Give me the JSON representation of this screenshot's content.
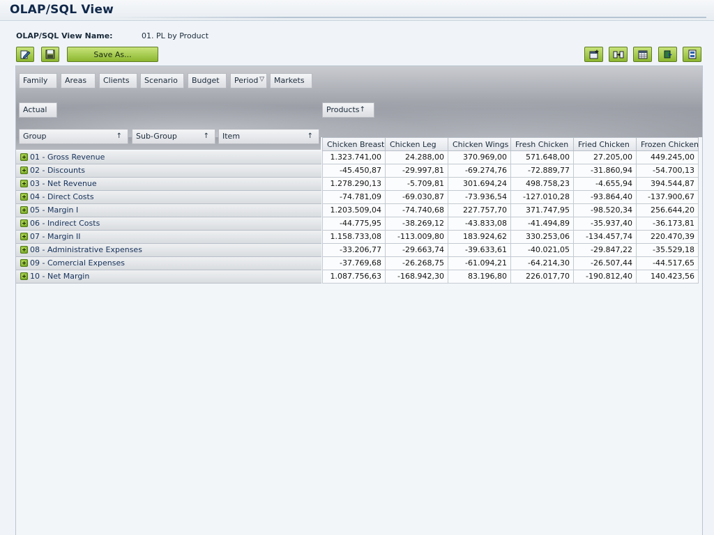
{
  "page": {
    "title": "OLAP/SQL View"
  },
  "view_name": {
    "label": "OLAP/SQL View Name:",
    "value": "01. PL by Product"
  },
  "toolbar": {
    "left": [
      {
        "name": "edit-button",
        "icon": "edit-icon"
      },
      {
        "name": "save-button",
        "icon": "save-icon"
      }
    ],
    "save_as_label": "Save As...",
    "right": [
      {
        "name": "new-view-button",
        "icon": "new-view-icon"
      },
      {
        "name": "swap-axes-button",
        "icon": "swap-axes-icon"
      },
      {
        "name": "grid-view-button",
        "icon": "grid-icon"
      },
      {
        "name": "export-button",
        "icon": "export-icon"
      },
      {
        "name": "settings-button",
        "icon": "settings-icon"
      }
    ]
  },
  "filter_dimensions": [
    "Family",
    "Areas",
    "Clients",
    "Scenario",
    "Budget",
    "Period",
    "Markets"
  ],
  "page_dimension": "Actual",
  "column_dimension": "Products",
  "row_dimensions": [
    "Group",
    "Sub-Group",
    "Item"
  ],
  "columns": [
    "Chicken Breast",
    "Chicken Leg",
    "Chicken Wings",
    "Fresh Chicken",
    "Fried Chicken",
    "Frozen Chicken"
  ],
  "rows": [
    {
      "label": "01 - Gross Revenue",
      "values": [
        "1.323.741,00",
        "24.288,00",
        "370.969,00",
        "571.648,00",
        "27.205,00",
        "449.245,00"
      ]
    },
    {
      "label": "02 - Discounts",
      "values": [
        "-45.450,87",
        "-29.997,81",
        "-69.274,76",
        "-72.889,77",
        "-31.860,94",
        "-54.700,13"
      ]
    },
    {
      "label": "03 - Net Revenue",
      "values": [
        "1.278.290,13",
        "-5.709,81",
        "301.694,24",
        "498.758,23",
        "-4.655,94",
        "394.544,87"
      ]
    },
    {
      "label": "04 - Direct Costs",
      "values": [
        "-74.781,09",
        "-69.030,87",
        "-73.936,54",
        "-127.010,28",
        "-93.864,40",
        "-137.900,67"
      ]
    },
    {
      "label": "05 - Margin I",
      "values": [
        "1.203.509,04",
        "-74.740,68",
        "227.757,70",
        "371.747,95",
        "-98.520,34",
        "256.644,20"
      ]
    },
    {
      "label": "06 - Indirect Costs",
      "values": [
        "-44.775,95",
        "-38.269,12",
        "-43.833,08",
        "-41.494,89",
        "-35.937,40",
        "-36.173,81"
      ]
    },
    {
      "label": "07 - Margin II",
      "values": [
        "1.158.733,08",
        "-113.009,80",
        "183.924,62",
        "330.253,06",
        "-134.457,74",
        "220.470,39"
      ]
    },
    {
      "label": "08 - Administrative Expenses",
      "values": [
        "-33.206,77",
        "-29.663,74",
        "-39.633,61",
        "-40.021,05",
        "-29.847,22",
        "-35.529,18"
      ]
    },
    {
      "label": "09 - Comercial Expenses",
      "values": [
        "-37.769,68",
        "-26.268,75",
        "-61.094,21",
        "-64.214,30",
        "-26.507,44",
        "-44.517,65"
      ]
    },
    {
      "label": "10 - Net Margin",
      "values": [
        "1.087.756,63",
        "-168.942,30",
        "83.196,80",
        "226.017,70",
        "-190.812,40",
        "140.423,56"
      ]
    }
  ]
}
